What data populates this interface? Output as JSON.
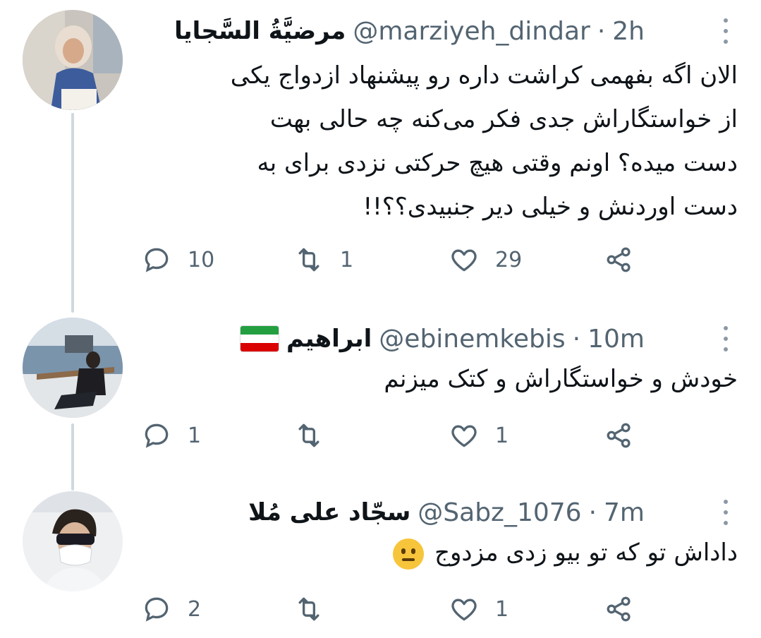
{
  "tweets": [
    {
      "name": "مرضیَّةُ السَّجایا",
      "handle": "@marziyeh_dindar",
      "separator": "·",
      "time": "2h",
      "lines": [
        "الان اگه بفهمی کراشت داره رو پیشنهاد ازدواج یکی",
        "از خواستگاراش جدی فکر می‌کنه چه حالی بهت",
        "دست میده؟ اونم وقتی هیچ حرکتی نزدی برای به",
        "دست اوردنش و خیلی دیر جنبیدی؟؟!!"
      ],
      "replies": "10",
      "retweets": "1",
      "likes": "29"
    },
    {
      "name": "ابراهیم",
      "handle": "@ebinemkebis",
      "separator": "·",
      "time": "10m",
      "lines": [
        "خودش و خواستگاراش و کتک میزنم"
      ],
      "replies": "1",
      "retweets": "",
      "likes": "1"
    },
    {
      "name": "سجّاد علی مُلا",
      "handle": "@Sabz_1076",
      "separator": "·",
      "time": "7m",
      "lines": [
        "داداش تو که تو بیو زدی مزدوج"
      ],
      "replies": "2",
      "retweets": "",
      "likes": "1"
    }
  ],
  "icons": {
    "reply": "reply-icon",
    "retweet": "retweet-icon",
    "like": "heart-icon",
    "share": "share-icon",
    "more": "more-icon",
    "flag": "iran-flag-icon",
    "emoji": "neutral-face-emoji"
  },
  "colors": {
    "text": "#0f1419",
    "secondary": "#536471",
    "thread_line": "#cfd9de"
  }
}
